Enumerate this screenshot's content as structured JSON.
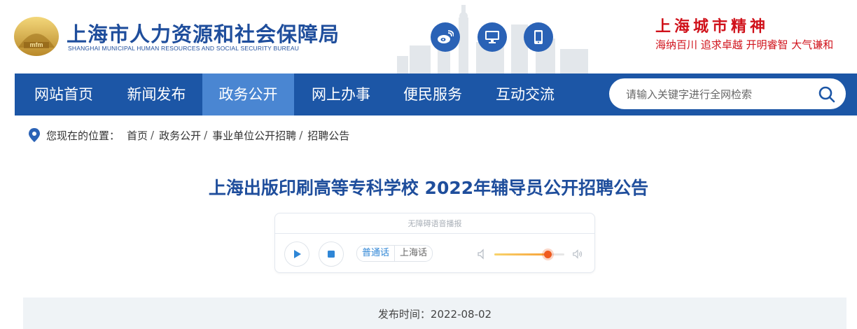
{
  "header": {
    "org_name_cn": "上海市人力资源和社会保障局",
    "org_name_en": "SHANGHAI MUNICIPAL HUMAN RESOURCES AND SOCIAL SECURITY BUREAU",
    "emblem_text": "mfm",
    "social_icons": [
      "weibo-icon",
      "desktop-icon",
      "mobile-icon"
    ],
    "city_spirit_title": "上海城市精神",
    "city_spirit_text": "海纳百川  追求卓越  开明睿智  大气谦和"
  },
  "nav": {
    "items": [
      {
        "label": "网站首页",
        "active": false
      },
      {
        "label": "新闻发布",
        "active": false
      },
      {
        "label": "政务公开",
        "active": true
      },
      {
        "label": "网上办事",
        "active": false
      },
      {
        "label": "便民服务",
        "active": false
      },
      {
        "label": "互动交流",
        "active": false
      }
    ],
    "search_placeholder": "请输入关键字进行全网检索"
  },
  "breadcrumb": {
    "prefix": "您现在的位置：",
    "items": [
      "首页",
      "政务公开",
      "事业单位公开招聘",
      "招聘公告"
    ],
    "separator": "/"
  },
  "article": {
    "title": "上海出版印刷高等专科学校 2022年辅导员公开招聘公告",
    "publish_label": "发布时间：",
    "publish_date": "2022-08-02"
  },
  "player": {
    "label": "无障碍语音播报",
    "lang_mandarin": "普通话",
    "lang_shanghainese": "上海话",
    "volume": 0.76
  },
  "colors": {
    "brand_blue": "#1c56a6",
    "active_nav": "#4a86d2",
    "title_blue": "#1f4e9c",
    "spirit_red": "#d0121b"
  }
}
